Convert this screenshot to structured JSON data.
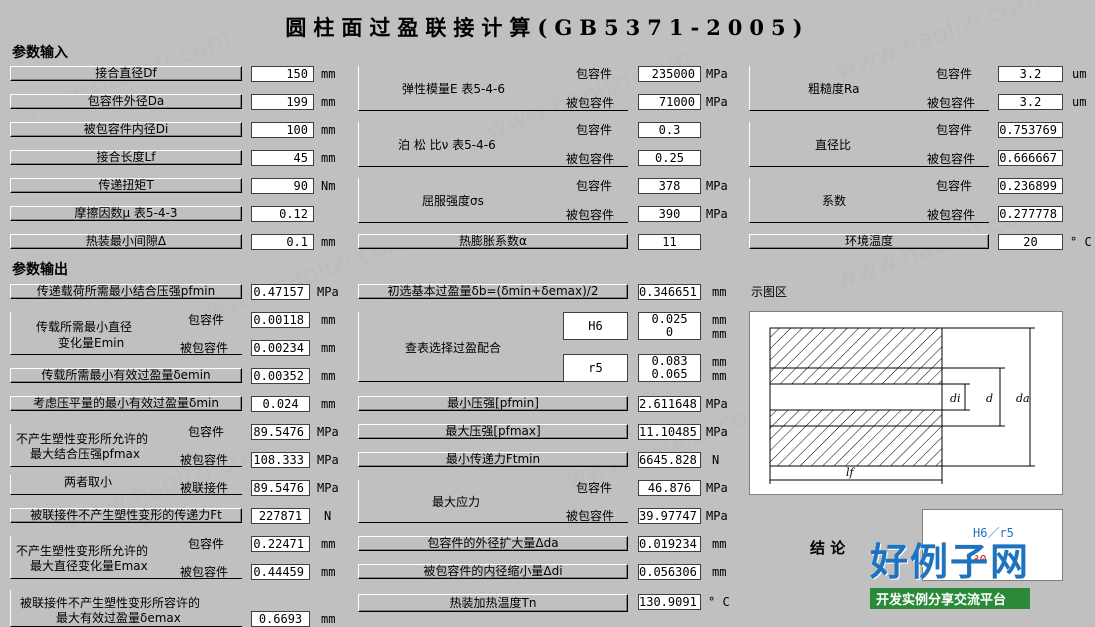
{
  "title": "圆柱面过盈联接计算(GB5371-2005)",
  "sections": {
    "input": "参数输入",
    "output": "参数输出"
  },
  "col1": {
    "df": {
      "label": "接合直径Df",
      "value": "150",
      "unit": "mm"
    },
    "da": {
      "label": "包容件外径Da",
      "value": "199",
      "unit": "mm"
    },
    "di": {
      "label": "被包容件内径Di",
      "value": "100",
      "unit": "mm"
    },
    "lf": {
      "label": "接合长度Lf",
      "value": "45",
      "unit": "mm"
    },
    "torque": {
      "label": "传递扭矩T",
      "value": "90",
      "unit": "Nm"
    },
    "friction": {
      "label": "摩擦因数μ 表5-4-3",
      "value": "0.12"
    },
    "gap": {
      "label": "热装最小间隙Δ",
      "value": "0.1",
      "unit": "mm"
    }
  },
  "col2": {
    "elastic": {
      "label": "弹性模量E 表5-4-6",
      "outer": "包容件",
      "inner": "被包容件",
      "v1": "235000",
      "v2": "71000",
      "unit": "MPa"
    },
    "poisson": {
      "label": "泊 松 比ν 表5-4-6",
      "outer": "包容件",
      "inner": "被包容件",
      "v1": "0.3",
      "v2": "0.25"
    },
    "yield": {
      "label": "屈服强度σs",
      "outer": "包容件",
      "inner": "被包容件",
      "v1": "378",
      "v2": "390",
      "unit": "MPa"
    },
    "thermal": {
      "label": "热膨胀系数α",
      "value": "11"
    }
  },
  "col3": {
    "rough": {
      "label": "粗糙度Ra",
      "outer": "包容件",
      "inner": "被包容件",
      "v1": "3.2",
      "v2": "3.2",
      "unit": "um"
    },
    "ratio": {
      "label": "直径比",
      "outer": "包容件",
      "inner": "被包容件",
      "v1": "0.753769",
      "v2": "0.666667"
    },
    "coef": {
      "label": "系数",
      "outer": "包容件",
      "inner": "被包容件",
      "v1": "0.236899",
      "v2": "0.277778"
    },
    "ambient": {
      "label": "环境温度",
      "value": "20",
      "unit": "° C"
    }
  },
  "out1": {
    "pfmin": {
      "label": "传递载荷所需最小结合压强pfmin",
      "value": "0.47157",
      "unit": "MPa"
    },
    "emin": {
      "label1": "传载所需最小直径",
      "label2": "变化量Emin",
      "outer": "包容件",
      "inner": "被包容件",
      "v1": "0.00118",
      "v2": "0.00234",
      "unit": "mm"
    },
    "demin": {
      "label": "传载所需最小有效过盈量δemin",
      "value": "0.00352",
      "unit": "mm"
    },
    "dmin": {
      "label": "考虑压平量的最小有效过盈量δmin",
      "value": "0.024",
      "unit": "mm"
    },
    "pfmax": {
      "label1": "不产生塑性变形所允许的",
      "label2": "最大结合压强pfmax",
      "outer": "包容件",
      "inner": "被包容件",
      "v1": "89.5476",
      "v2": "108.333",
      "unit": "MPa"
    },
    "both": {
      "label": "两者取小",
      "inner": "被联接件",
      "value": "89.5476",
      "unit": "MPa"
    },
    "ft": {
      "label": "被联接件不产生塑性变形的传递力Ft",
      "value": "227871",
      "unit": "N"
    },
    "emax": {
      "label1": "不产生塑性变形所允许的",
      "label2": "最大直径变化量Emax",
      "outer": "包容件",
      "inner": "被包容件",
      "v1": "0.22471",
      "v2": "0.44459",
      "unit": "mm"
    },
    "demax": {
      "label1": "被联接件不产生塑性变形所容许的",
      "label2": "最大有效过盈量δemax",
      "value": "0.6693",
      "unit": "mm"
    }
  },
  "out2": {
    "db": {
      "label": "初选基本过盈量δb=(δmin+δemax)/2",
      "value": "0.346651",
      "unit": "mm"
    },
    "fit": {
      "label": "查表选择过盈配合",
      "hole": "H6",
      "h_up": "0.025",
      "h_low": "0",
      "shaft": "r5",
      "s_up": "0.083",
      "s_low": "0.065",
      "unit": "mm"
    },
    "pmin": {
      "label": "最小压强[pfmin]",
      "value": "2.611648",
      "unit": "MPa"
    },
    "pmax": {
      "label": "最大压强[pfmax]",
      "value": "11.10485",
      "unit": "MPa"
    },
    "ftmin": {
      "label": "最小传递力Ftmin",
      "value": "6645.828",
      "unit": "N"
    },
    "stress": {
      "label": "最大应力",
      "outer": "包容件",
      "inner": "被包容件",
      "v1": "46.876",
      "v2": "39.97747",
      "unit": "MPa"
    },
    "expand": {
      "label": "包容件的外径扩大量Δda",
      "value": "0.019234",
      "unit": "mm"
    },
    "shrink": {
      "label": "被包容件的内径缩小量Δdi",
      "value": "0.056306",
      "unit": "mm"
    },
    "tn": {
      "label": "热装加热温度Tn",
      "value": "130.9091",
      "unit": "° C"
    }
  },
  "diagram": {
    "title": "示图区",
    "d_label": "d",
    "di_label": "di",
    "da_label": "da",
    "lf_label": "lf"
  },
  "conclusion": {
    "label": "结 论",
    "fit": "H6／r5",
    "temp": "130"
  },
  "watermark": "www.haolizi.com",
  "logo": {
    "main": "好例子网",
    "sub": "开发实例分享交流平台"
  },
  "colors": {
    "bg": "#c0c0c0",
    "logo_blue": "#1e73be",
    "logo_bar": "#2a8a3a"
  }
}
